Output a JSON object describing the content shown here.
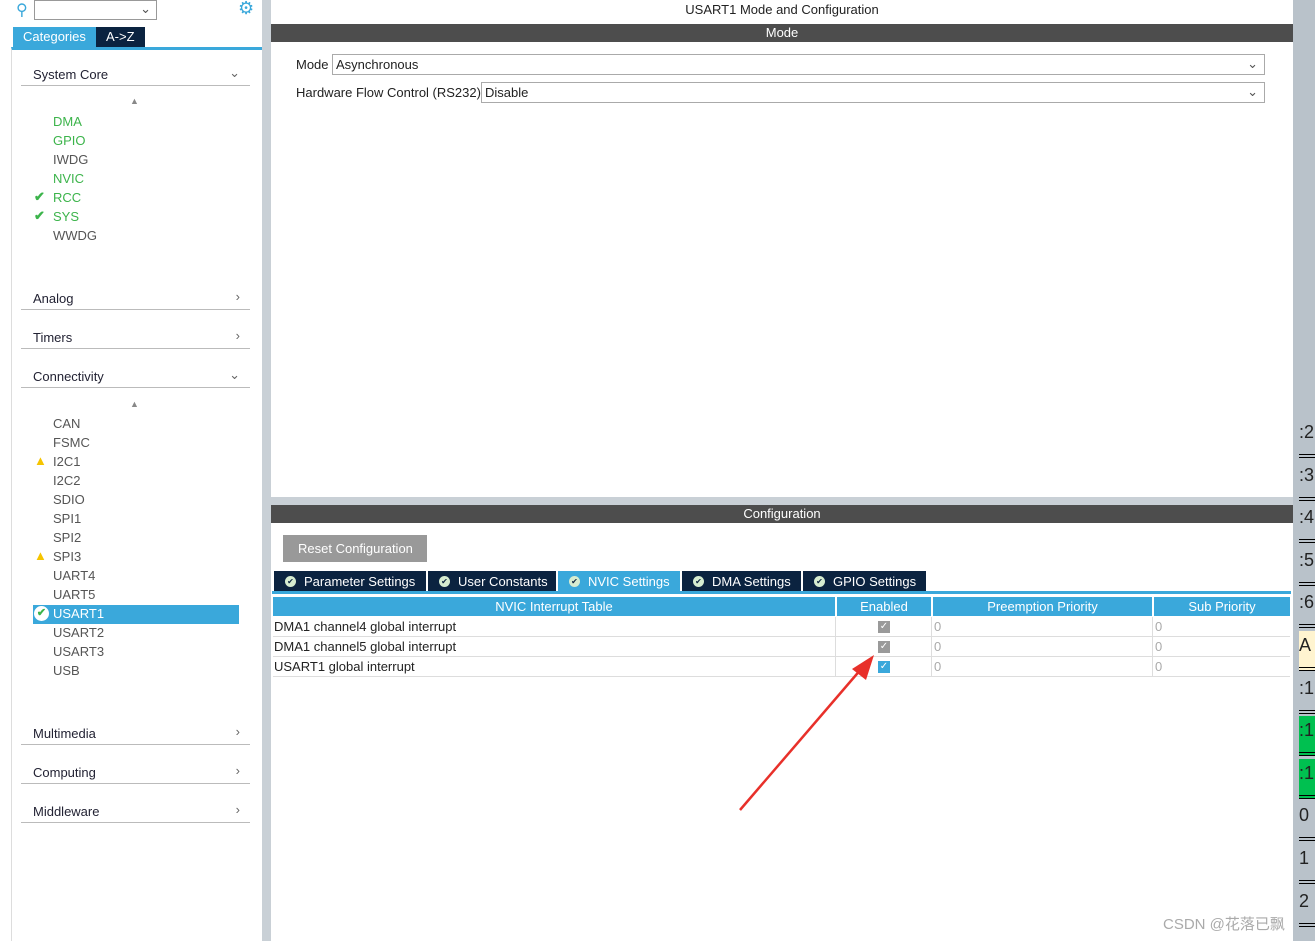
{
  "sidebar": {
    "tabs": [
      "Categories",
      "A->Z"
    ],
    "categories": {
      "system_core": "System Core",
      "analog": "Analog",
      "timers": "Timers",
      "connectivity": "Connectivity",
      "multimedia": "Multimedia",
      "computing": "Computing",
      "middleware": "Middleware"
    },
    "system_core_items": [
      {
        "label": "DMA",
        "status": "configured"
      },
      {
        "label": "GPIO",
        "status": "configured"
      },
      {
        "label": "IWDG",
        "status": "none"
      },
      {
        "label": "NVIC",
        "status": "configured"
      },
      {
        "label": "RCC",
        "status": "checked"
      },
      {
        "label": "SYS",
        "status": "checked"
      },
      {
        "label": "WWDG",
        "status": "none"
      }
    ],
    "connectivity_items": [
      {
        "label": "CAN",
        "status": "none"
      },
      {
        "label": "FSMC",
        "status": "none"
      },
      {
        "label": "I2C1",
        "status": "warning"
      },
      {
        "label": "I2C2",
        "status": "none"
      },
      {
        "label": "SDIO",
        "status": "none"
      },
      {
        "label": "SPI1",
        "status": "none"
      },
      {
        "label": "SPI2",
        "status": "none"
      },
      {
        "label": "SPI3",
        "status": "warning"
      },
      {
        "label": "UART4",
        "status": "none"
      },
      {
        "label": "UART5",
        "status": "none"
      },
      {
        "label": "USART1",
        "status": "selected"
      },
      {
        "label": "USART2",
        "status": "none"
      },
      {
        "label": "USART3",
        "status": "none"
      },
      {
        "label": "USB",
        "status": "none"
      }
    ]
  },
  "main": {
    "title": "USART1 Mode and Configuration",
    "mode_header": "Mode",
    "mode_label": "Mode",
    "mode_value": "Asynchronous",
    "hfc_label": "Hardware Flow Control (RS232)",
    "hfc_value": "Disable",
    "config_header": "Configuration",
    "reset_button": "Reset Configuration",
    "tabs": [
      "Parameter Settings",
      "User Constants",
      "NVIC Settings",
      "DMA Settings",
      "GPIO Settings"
    ],
    "active_tab": "NVIC Settings",
    "table": {
      "headers": [
        "NVIC Interrupt Table",
        "Enabled",
        "Preemption Priority",
        "Sub Priority"
      ],
      "rows": [
        {
          "name": "DMA1 channel4 global interrupt",
          "enabled": true,
          "locked": true,
          "preemption": "0",
          "sub": "0"
        },
        {
          "name": "DMA1 channel5 global interrupt",
          "enabled": true,
          "locked": true,
          "preemption": "0",
          "sub": "0"
        },
        {
          "name": "USART1 global interrupt",
          "enabled": true,
          "locked": false,
          "preemption": "0",
          "sub": "0"
        }
      ]
    }
  },
  "pin_strip": [
    ":2",
    ":3",
    ":4",
    ":5",
    ":6",
    "A",
    ":1",
    ":1",
    ":1",
    "0",
    "1",
    "2"
  ],
  "watermark": "CSDN @花落已飘",
  "colors": {
    "accent": "#3aa8db",
    "dark_tab": "#0b2340",
    "configured": "#3cb44b",
    "warning": "#f5c400",
    "annotation_arrow": "#e8302a"
  }
}
